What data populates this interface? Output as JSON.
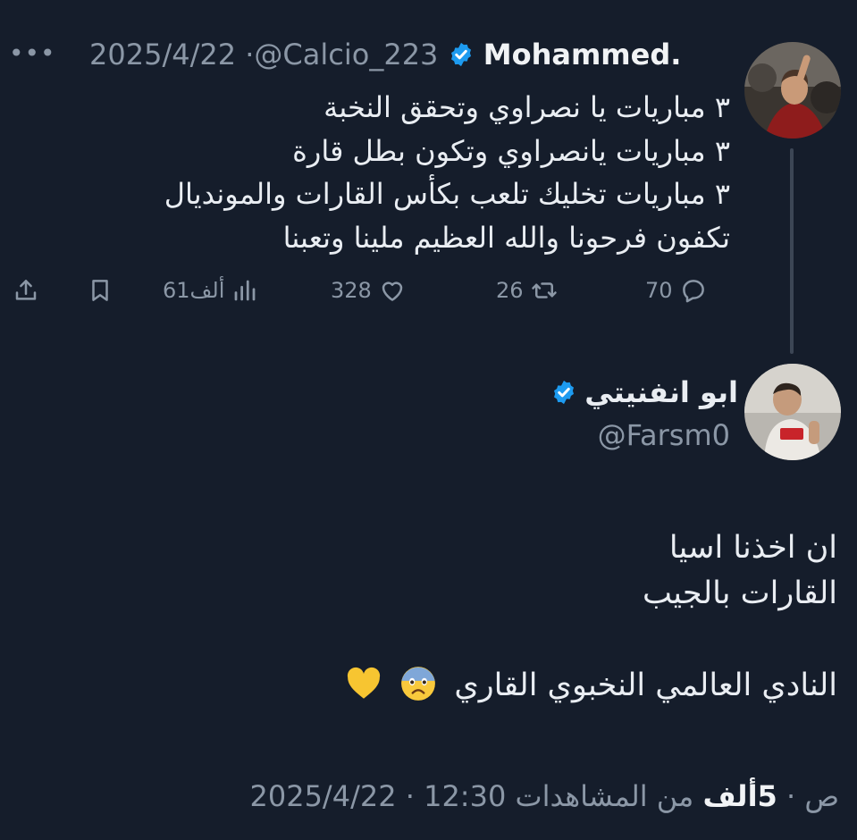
{
  "original_tweet": {
    "more_label": "•••",
    "date": "2025/4/22",
    "separator": "·",
    "handle": "@Calcio_223",
    "display_name": "Mohammed.",
    "verified": true,
    "lines": [
      "٣ مباريات يا نصراوي وتحقق النخبة",
      "٣ مباريات يانصراوي وتكون بطل قارة",
      "٣ مباريات تخليك تلعب بكأس القارات والمونديال",
      "تكفون فرحونا والله العظيم ملينا وتعبنا"
    ],
    "actions": {
      "replies": "70",
      "reposts": "26",
      "likes": "328",
      "views": "61ألف"
    }
  },
  "reply_tweet": {
    "display_name": "ابو انفنيتي",
    "verified": true,
    "handle": "@Farsm0",
    "lines": [
      "ان اخذنا اسيا",
      "القارات بالجيب",
      "",
      "النادي العالمي النخبوي القاري"
    ],
    "emojis": [
      "anxious-face-icon",
      "yellow-heart-icon"
    ],
    "footer": {
      "date": "2025/4/22",
      "time": "12:30 ص",
      "views_count": "5ألف",
      "views_label": "من المشاهدات",
      "separator": "·"
    }
  },
  "colors": {
    "background": "#151d2b",
    "verified_blue": "#1d9bf0",
    "muted": "#8b97a6",
    "text": "#e9edf2",
    "heart_yellow": "#f7c531"
  }
}
